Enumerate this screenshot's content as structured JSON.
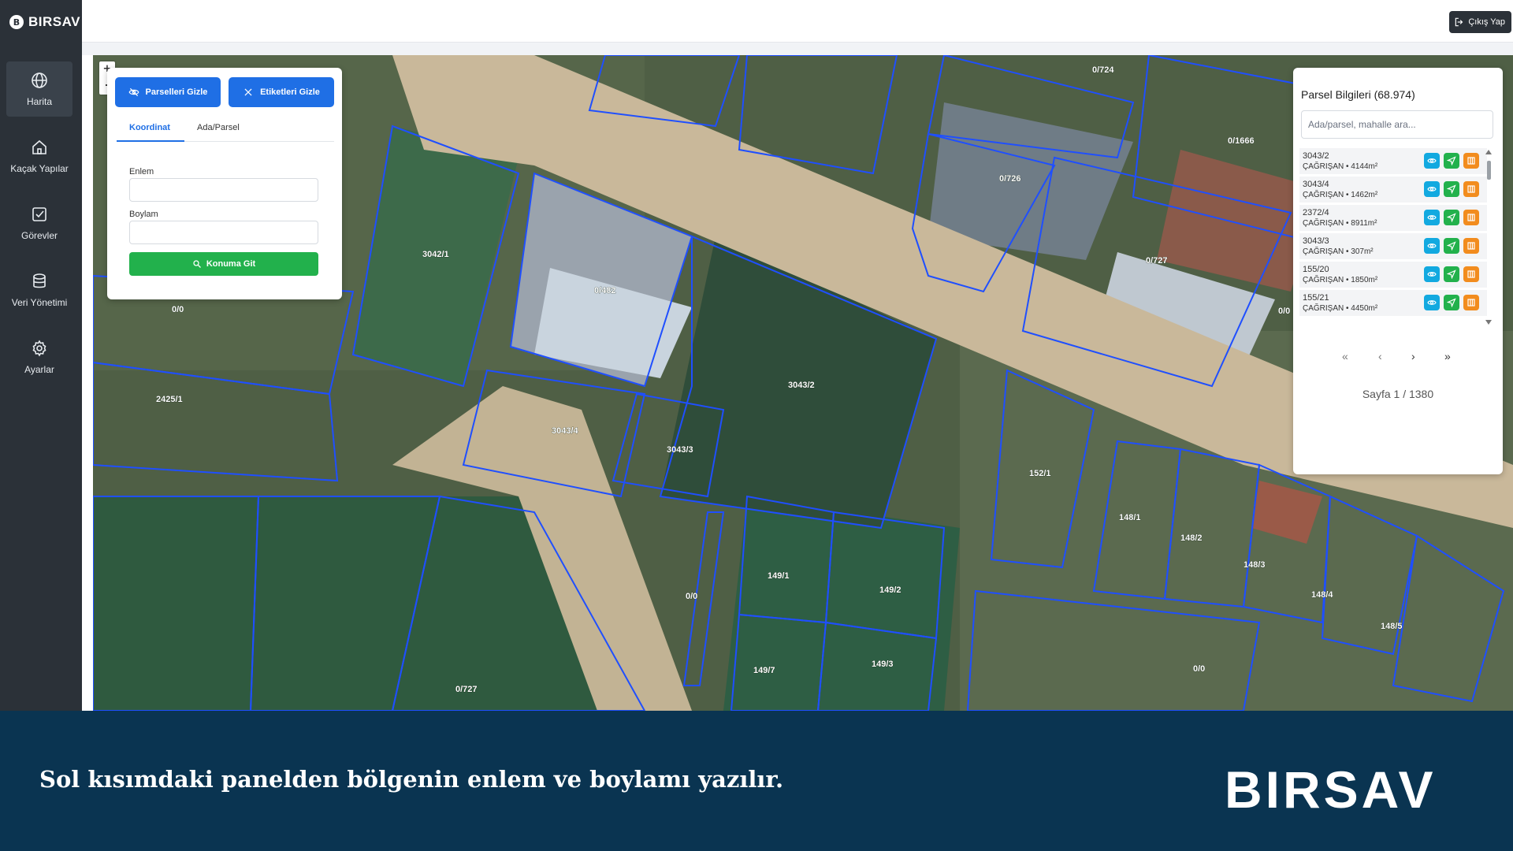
{
  "app": {
    "brand": "BIRSAV",
    "logo_glyph": "B"
  },
  "sidebar": {
    "items": [
      {
        "label": "Harita",
        "icon": "globe-icon",
        "active": true
      },
      {
        "label": "Kaçak Yapılar",
        "icon": "home-icon",
        "active": false
      },
      {
        "label": "Görevler",
        "icon": "checkbox-icon",
        "active": false
      },
      {
        "label": "Veri Yönetimi",
        "icon": "database-icon",
        "active": false
      },
      {
        "label": "Ayarlar",
        "icon": "gear-icon",
        "active": false
      }
    ]
  },
  "topbar": {
    "logout_label": "Çıkış Yap"
  },
  "map": {
    "zoom_in": "+",
    "zoom_out": "-",
    "parcel_labels": [
      "0/724",
      "0/1666",
      "0/726",
      "0/727",
      "3042/1",
      "0/482",
      "0/0",
      "2425/1",
      "3043/2",
      "3043/4",
      "3043/3",
      "152/1",
      "148/1",
      "148/2",
      "148/3",
      "148/4",
      "148/5",
      "149/1",
      "149/2",
      "149/7",
      "149/3",
      "0/0",
      "0/0",
      "0/727",
      "0/0"
    ]
  },
  "search_panel": {
    "hide_parcels_label": "Parselleri Gizle",
    "hide_labels_label": "Etiketleri Gizle",
    "tabs": [
      "Koordinat",
      "Ada/Parsel"
    ],
    "active_tab": "Koordinat",
    "lat_label": "Enlem",
    "lat_value": "",
    "lon_label": "Boylam",
    "lon_value": "",
    "go_label": "Konuma Git"
  },
  "parcel_panel": {
    "title": "Parsel Bilgileri (68.974)",
    "search_placeholder": "Ada/parsel, mahalle ara...",
    "rows": [
      {
        "id": "3043/2",
        "info": "ÇAĞRIŞAN • 4144m²"
      },
      {
        "id": "3043/4",
        "info": "ÇAĞRIŞAN • 1462m²"
      },
      {
        "id": "2372/4",
        "info": "ÇAĞRIŞAN • 8911m²"
      },
      {
        "id": "3043/3",
        "info": "ÇAĞRIŞAN • 307m²"
      },
      {
        "id": "155/20",
        "info": "ÇAĞRIŞAN • 1850m²"
      },
      {
        "id": "155/21",
        "info": "ÇAĞRIŞAN • 4450m²"
      }
    ],
    "pager": {
      "first": "«",
      "prev": "‹",
      "next": "›",
      "last": "»"
    },
    "page_info": "Sayfa 1 / 1380"
  },
  "banner": {
    "caption": "Sol kısımdaki panelden bölgenin enlem ve boylamı yazılır.",
    "brand": "BIRSAV"
  },
  "colors": {
    "sidebar": "#2b3138",
    "primary": "#1f6fe5",
    "success": "#22b14c",
    "info": "#12a9e0",
    "warning": "#f28c1e",
    "banner": "#0a3451",
    "parcel_stroke": "#1f4fff"
  }
}
